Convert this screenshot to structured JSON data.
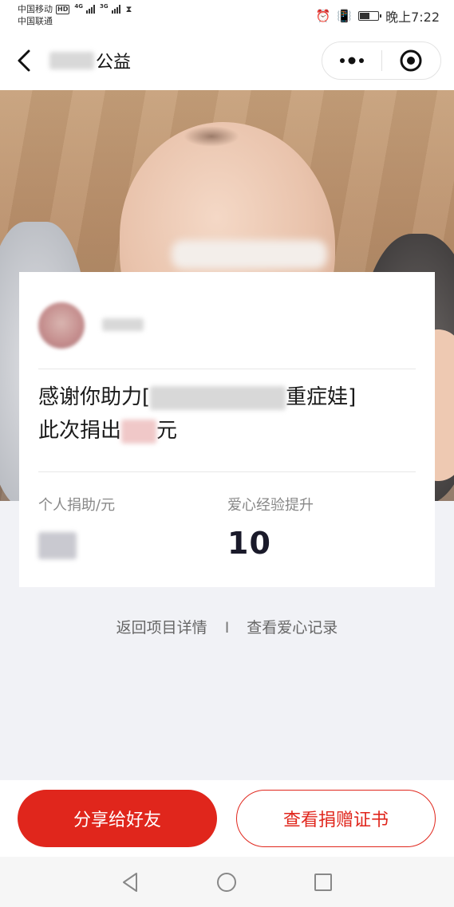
{
  "status_bar": {
    "carrier1": "中国移动",
    "carrier1_badge": "HD",
    "carrier1_net": "4G",
    "carrier2": "中国联通",
    "carrier2_net": "3G",
    "time": "晚上7:22",
    "battery_level": 0.6
  },
  "nav": {
    "title_suffix": "公益"
  },
  "card": {
    "thanks_prefix": "感谢你助力[",
    "thanks_suffix": "重症娃]",
    "donation_prefix": "此次捐出",
    "donation_suffix": "元",
    "stats": {
      "personal_label": "个人捐助/元",
      "love_label": "爱心经验提升",
      "love_value": "10"
    }
  },
  "links": {
    "back_to_project": "返回项目详情",
    "separator": "I",
    "view_records": "查看爱心记录"
  },
  "actions": {
    "share": "分享给好友",
    "certificate": "查看捐赠证书"
  },
  "colors": {
    "accent": "#e0261c",
    "background": "#f1f2f6"
  }
}
